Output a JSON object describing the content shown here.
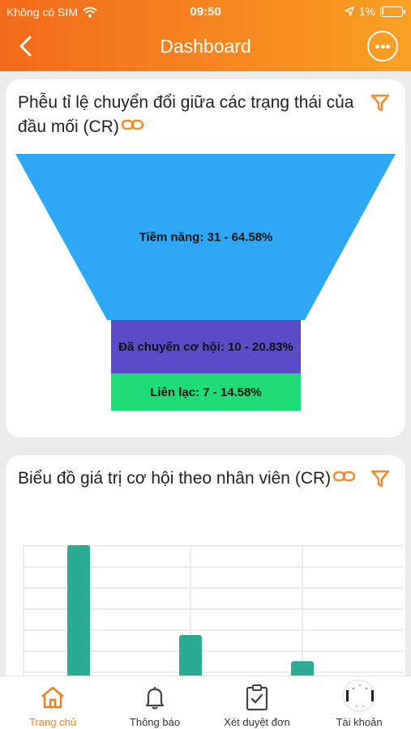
{
  "status_bar": {
    "carrier": "Không có SIM",
    "time": "09:50",
    "battery": "1%"
  },
  "nav": {
    "title": "Dashboard",
    "back_icon": "chevron-left-icon",
    "chat_icon": "chat-bubble-icon"
  },
  "funnel_card": {
    "title": "Phễu tỉ lệ chuyển đổi giữa các trạng thái của đầu mối (CR)",
    "link_icon": "link-icon",
    "filter_icon": "filter-icon",
    "chart_data": {
      "type": "funnel",
      "stages": [
        {
          "label": "Tiềm năng: 31 - 64.58%",
          "name": "Tiềm năng",
          "value": 31,
          "percent": 64.58,
          "color": "#2ea8f5"
        },
        {
          "label": "Đã chuyển cơ hội: 10 - 20.83%",
          "name": "Đã chuyển cơ hội",
          "value": 10,
          "percent": 20.83,
          "color": "#5a4cc6"
        },
        {
          "label": "Liên lạc: 7 - 14.58%",
          "name": "Liên lạc",
          "value": 7,
          "percent": 14.58,
          "color": "#1fdc78"
        }
      ]
    }
  },
  "bar_card": {
    "title": "Biểu đồ giá trị cơ hội theo nhân viên (CR)",
    "link_icon": "link-icon",
    "filter_icon": "filter-icon",
    "chart_data": {
      "type": "bar",
      "categories": [
        "",
        "",
        ""
      ],
      "values": [
        100,
        38,
        20
      ],
      "color": "#2aab92",
      "grid": true
    }
  },
  "bottom_nav": {
    "tabs": [
      {
        "label": "Trang chủ",
        "icon": "home-icon",
        "active": true
      },
      {
        "label": "Thông báo",
        "icon": "bell-icon",
        "active": false
      },
      {
        "label": "Xét duyệt đơn",
        "icon": "clipboard-check-icon",
        "active": false
      },
      {
        "label": "Tài khoản",
        "icon": "avatar",
        "active": false
      }
    ],
    "accent": "#f57c1f"
  }
}
